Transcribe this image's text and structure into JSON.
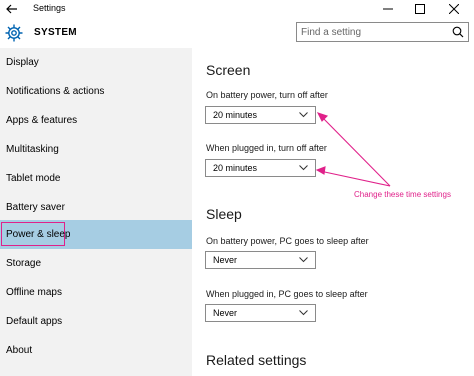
{
  "window": {
    "title": "Settings"
  },
  "header": {
    "section": "SYSTEM",
    "search_placeholder": "Find a setting"
  },
  "sidebar": {
    "items": [
      {
        "label": "Display"
      },
      {
        "label": "Notifications & actions"
      },
      {
        "label": "Apps & features"
      },
      {
        "label": "Multitasking"
      },
      {
        "label": "Tablet mode"
      },
      {
        "label": "Battery saver"
      },
      {
        "label": "Power & sleep",
        "selected": true
      },
      {
        "label": "Storage"
      },
      {
        "label": "Offline maps"
      },
      {
        "label": "Default apps"
      },
      {
        "label": "About"
      }
    ]
  },
  "screen": {
    "heading": "Screen",
    "battery_label": "On battery power, turn off after",
    "battery_value": "20 minutes",
    "plugged_label": "When plugged in, turn off after",
    "plugged_value": "20 minutes"
  },
  "sleep": {
    "heading": "Sleep",
    "battery_label": "On battery power, PC goes to sleep after",
    "battery_value": "Never",
    "plugged_label": "When plugged in, PC goes to sleep after",
    "plugged_value": "Never"
  },
  "related": {
    "heading": "Related settings"
  },
  "annotation": {
    "text": "Change these time settings",
    "color": "#e0218a"
  },
  "colors": {
    "selected_bg": "#a6cde3",
    "sidebar_bg": "#f2f2f2",
    "accent": "#0063b1"
  }
}
